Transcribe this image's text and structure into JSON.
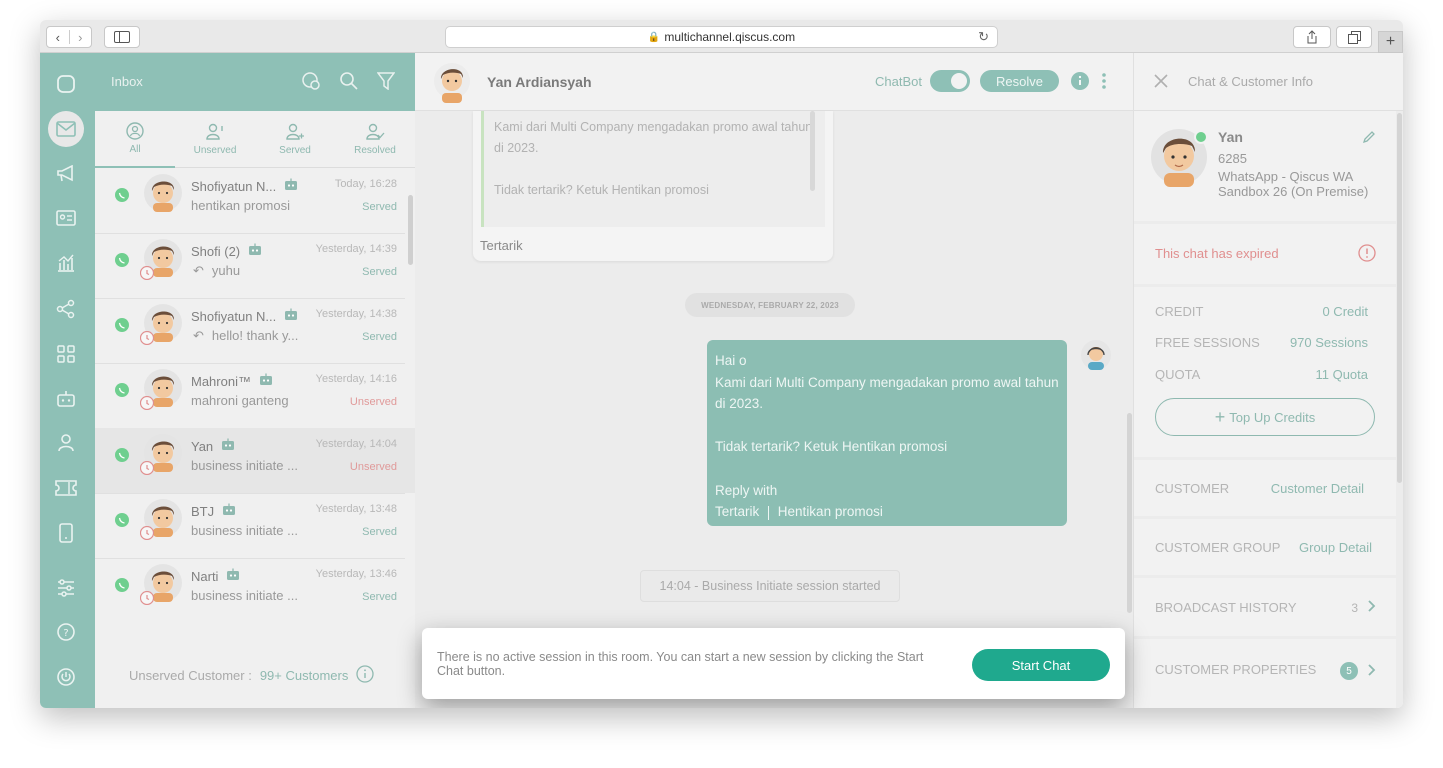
{
  "browser": {
    "url": "multichannel.qiscus.com"
  },
  "inbox": {
    "title": "Inbox",
    "tabs": [
      {
        "label": "All"
      },
      {
        "label": "Unserved"
      },
      {
        "label": "Served"
      },
      {
        "label": "Resolved"
      }
    ],
    "conversations": [
      {
        "name": "Shofiyatun N...",
        "time": "Today, 16:28",
        "preview": "hentikan promosi",
        "status": "Served",
        "replied": false,
        "expired": false
      },
      {
        "name": "Shofi (2)",
        "time": "Yesterday, 14:39",
        "preview": "yuhu",
        "status": "Served",
        "replied": true,
        "expired": true
      },
      {
        "name": "Shofiyatun N...",
        "time": "Yesterday, 14:38",
        "preview": "hello! thank y...",
        "status": "Served",
        "replied": true,
        "expired": true
      },
      {
        "name": "Mahroni™",
        "time": "Yesterday, 14:16",
        "preview": "mahroni ganteng",
        "status": "Unserved",
        "replied": false,
        "expired": true
      },
      {
        "name": "Yan",
        "time": "Yesterday, 14:04",
        "preview": "business initiate ...",
        "status": "Unserved",
        "replied": false,
        "expired": true
      },
      {
        "name": "BTJ",
        "time": "Yesterday, 13:48",
        "preview": "business initiate ...",
        "status": "Served",
        "replied": false,
        "expired": true
      },
      {
        "name": "Narti",
        "time": "Yesterday, 13:46",
        "preview": "business initiate ...",
        "status": "Served",
        "replied": false,
        "expired": true
      }
    ],
    "footer_label": "Unserved Customer :",
    "footer_count": "99+ Customers"
  },
  "chat": {
    "contact_name": "Yan Ardiansyah",
    "chatbot_label": "ChatBot",
    "resolve_label": "Resolve",
    "quoted_line1": "Kami dari Multi Company mengadakan promo awal tahun",
    "quoted_line2": "di 2023.",
    "quoted_line3": "Tidak tertarik? Ketuk Hentikan promosi",
    "reply_text": "Tertarik",
    "date_divider": "WEDNESDAY, FEBRUARY 22, 2023",
    "out_line1": "Hai o",
    "out_line2": "Kami dari Multi Company mengadakan promo awal tahun",
    "out_line3": "di 2023.",
    "out_line4": "Tidak tertarik? Ketuk Hentikan promosi",
    "out_line5": "Reply with",
    "out_opt1": "Tertarik",
    "out_opt2": "Hentikan promosi",
    "system_message": "14:04 - Business Initiate session started",
    "session_notice": "There is no active session in this room. You can start a new session by clicking the Start Chat button.",
    "start_chat_label": "Start Chat"
  },
  "info": {
    "title": "Chat & Customer Info",
    "customer_name": "Yan",
    "customer_phone": "6285",
    "customer_channel": "WhatsApp - Qiscus WA Sandbox 26 (On Premise)",
    "expired_notice": "This chat has expired",
    "credit_label": "CREDIT",
    "credit_value": "0 Credit",
    "sessions_label": "FREE SESSIONS",
    "sessions_value": "970 Sessions",
    "quota_label": "QUOTA",
    "quota_value": "11 Quota",
    "topup_label": "Top Up Credits",
    "customer_label": "CUSTOMER",
    "customer_detail": "Customer Detail",
    "group_label": "CUSTOMER GROUP",
    "group_detail": "Group Detail",
    "broadcast_label": "BROADCAST HISTORY",
    "broadcast_count": "3",
    "properties_label": "CUSTOMER PROPERTIES",
    "properties_count": "5"
  },
  "colors": {
    "primary": "#8ec0b6",
    "accent": "#1fa98e",
    "expired": "#e08f8f"
  }
}
